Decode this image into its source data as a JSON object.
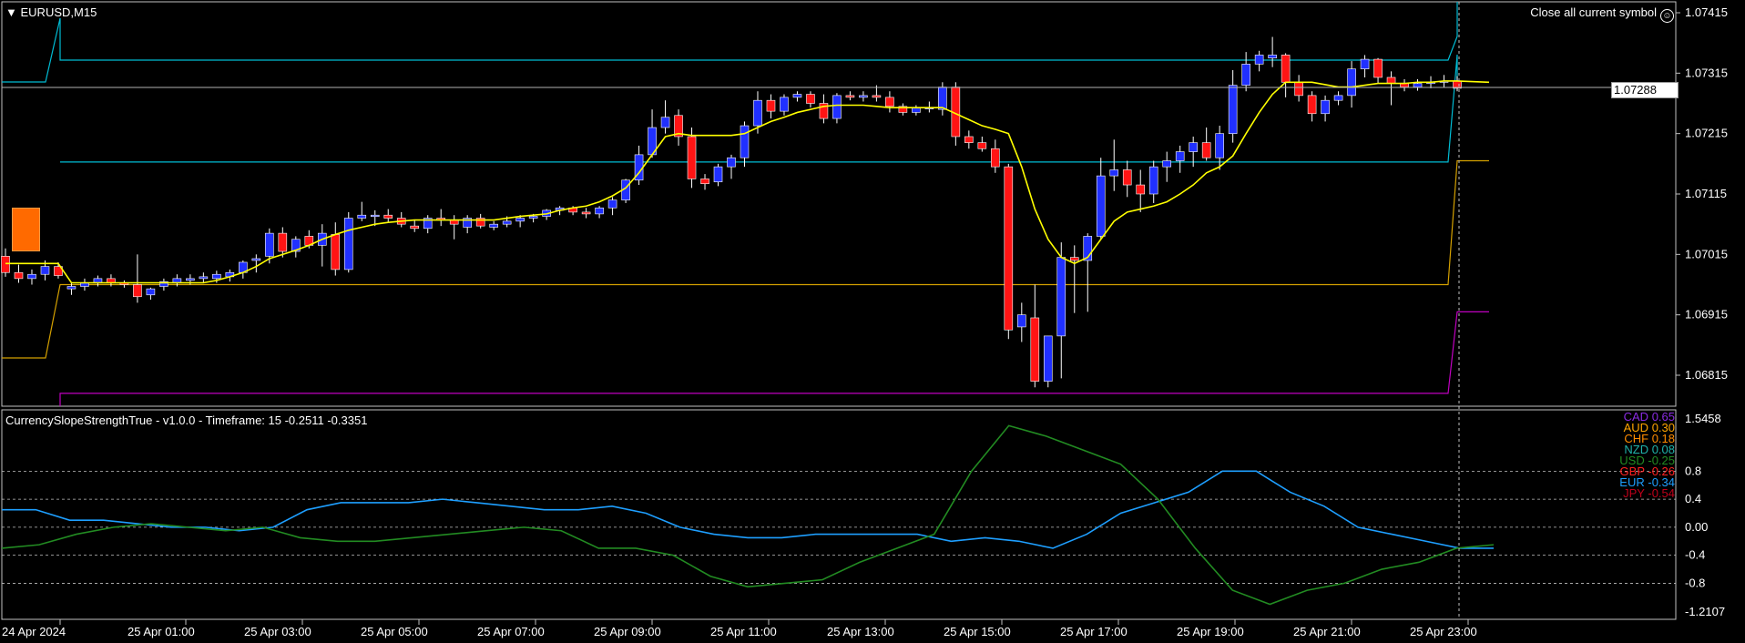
{
  "colors": {
    "background": "#000000",
    "bull_candle": "#2030ff",
    "bear_candle": "#ff1414",
    "ma_line": "#ffff00",
    "channel_upper": "#00bcd4",
    "channel_gold": "#d4a000",
    "channel_purple": "#c000c0",
    "grid": "#c0c0c0",
    "axis_text": "#ffffff"
  },
  "header": {
    "symbol": "EURUSD,M15",
    "close_all_label": "Close all current symbol",
    "smile_icon": "smiley-icon"
  },
  "price_axis": {
    "labels": [
      "1.07415",
      "1.07315",
      "1.07215",
      "1.07115",
      "1.07015",
      "1.06915",
      "1.06815"
    ],
    "current_price": "1.07288"
  },
  "indicator": {
    "title": "CurrencySlopeStrengthTrue  -  v1.0.0  -  Timeframe: 15    -0.2511 -0.3351",
    "axis_labels": [
      "1.5458",
      "0.8",
      "0.4",
      "0.00",
      "-0.4",
      "-0.8",
      "-1.2107"
    ],
    "legend": [
      {
        "name": "CAD",
        "value": "0.65",
        "color": "#8a2be2"
      },
      {
        "name": "AUD",
        "value": "0.30",
        "color": "#ffa500"
      },
      {
        "name": "CHF",
        "value": "0.18",
        "color": "#ff8c00"
      },
      {
        "name": "NZD",
        "value": "0.08",
        "color": "#20b2aa"
      },
      {
        "name": "USD",
        "value": "-0.25",
        "color": "#228b22"
      },
      {
        "name": "GBP",
        "value": "-0.26",
        "color": "#ff2020"
      },
      {
        "name": "EUR",
        "value": "-0.34",
        "color": "#1e9fff"
      },
      {
        "name": "JPY",
        "value": "-0.54",
        "color": "#c0001a"
      }
    ]
  },
  "time_axis": {
    "labels": [
      "24 Apr 2024",
      "25 Apr 01:00",
      "25 Apr 03:00",
      "25 Apr 05:00",
      "25 Apr 07:00",
      "25 Apr 09:00",
      "25 Apr 11:00",
      "25 Apr 13:00",
      "25 Apr 15:00",
      "25 Apr 17:00",
      "25 Apr 19:00",
      "25 Apr 21:00",
      "25 Apr 23:00"
    ]
  },
  "chart_data": {
    "type": "candlestick",
    "symbol": "EURUSD",
    "timeframe": "M15",
    "ylim": [
      1.0676,
      1.0746
    ],
    "candles": [
      [
        1.07012,
        1.07025,
        1.06978,
        1.06985
      ],
      [
        1.06985,
        1.06998,
        1.06968,
        1.06975
      ],
      [
        1.06975,
        1.0699,
        1.06965,
        1.06982
      ],
      [
        1.06982,
        1.07005,
        1.06972,
        1.06995
      ],
      [
        1.06995,
        1.07002,
        1.06975,
        1.0698
      ],
      [
        1.06958,
        1.06968,
        1.06948,
        1.06962
      ],
      [
        1.06962,
        1.06975,
        1.06955,
        1.06968
      ],
      [
        1.06968,
        1.0698,
        1.06962,
        1.06975
      ],
      [
        1.06975,
        1.06982,
        1.06962,
        1.06968
      ],
      [
        1.06968,
        1.06972,
        1.0696,
        1.06965
      ],
      [
        1.06965,
        1.07015,
        1.06935,
        1.06945
      ],
      [
        1.06948,
        1.0696,
        1.0694,
        1.06958
      ],
      [
        1.06962,
        1.06975,
        1.06955,
        1.0697
      ],
      [
        1.06968,
        1.06982,
        1.06962,
        1.06975
      ],
      [
        1.06972,
        1.06982,
        1.06965,
        1.06975
      ],
      [
        1.06975,
        1.06985,
        1.06968,
        1.06978
      ],
      [
        1.06975,
        1.06988,
        1.06968,
        1.06982
      ],
      [
        1.06978,
        1.0699,
        1.0697,
        1.06985
      ],
      [
        1.06985,
        1.07005,
        1.06975,
        1.07002
      ],
      [
        1.07005,
        1.07015,
        1.06985,
        1.07008
      ],
      [
        1.07012,
        1.07058,
        1.07,
        1.0705
      ],
      [
        1.0705,
        1.0706,
        1.0701,
        1.0702
      ],
      [
        1.0702,
        1.07045,
        1.0701,
        1.0704
      ],
      [
        1.07045,
        1.07055,
        1.07025,
        1.0703
      ],
      [
        1.0703,
        1.07065,
        1.06995,
        1.0705
      ],
      [
        1.07048,
        1.07068,
        1.0698,
        1.0699
      ],
      [
        1.0699,
        1.07085,
        1.06985,
        1.07075
      ],
      [
        1.07075,
        1.07102,
        1.0707,
        1.0708
      ],
      [
        1.0708,
        1.07088,
        1.07062,
        1.0708
      ],
      [
        1.0708,
        1.0709,
        1.07068,
        1.07075
      ],
      [
        1.07075,
        1.07085,
        1.0706,
        1.07065
      ],
      [
        1.07062,
        1.07072,
        1.07052,
        1.07058
      ],
      [
        1.07058,
        1.0708,
        1.0705,
        1.07075
      ],
      [
        1.07075,
        1.0709,
        1.07062,
        1.07072
      ],
      [
        1.07072,
        1.0708,
        1.0704,
        1.07065
      ],
      [
        1.0706,
        1.0708,
        1.0705,
        1.07075
      ],
      [
        1.07075,
        1.07082,
        1.07058,
        1.07062
      ],
      [
        1.0706,
        1.0707,
        1.07055,
        1.07065
      ],
      [
        1.07065,
        1.07078,
        1.0706,
        1.0707
      ],
      [
        1.0707,
        1.0708,
        1.0706,
        1.07075
      ],
      [
        1.07075,
        1.07082,
        1.07068,
        1.07078
      ],
      [
        1.07078,
        1.0709,
        1.07072,
        1.07088
      ],
      [
        1.07088,
        1.07095,
        1.0708,
        1.07092
      ],
      [
        1.07092,
        1.07095,
        1.0708,
        1.07085
      ],
      [
        1.07085,
        1.07092,
        1.07075,
        1.07082
      ],
      [
        1.07082,
        1.07095,
        1.07075,
        1.07092
      ],
      [
        1.07092,
        1.0711,
        1.0708,
        1.07105
      ],
      [
        1.07105,
        1.0714,
        1.071,
        1.07138
      ],
      [
        1.07138,
        1.07195,
        1.0713,
        1.0718
      ],
      [
        1.0718,
        1.07255,
        1.07175,
        1.07225
      ],
      [
        1.07225,
        1.0727,
        1.07215,
        1.07242
      ],
      [
        1.07245,
        1.07255,
        1.07195,
        1.0721
      ],
      [
        1.0721,
        1.07225,
        1.07125,
        1.0714
      ],
      [
        1.0714,
        1.07148,
        1.07122,
        1.07132
      ],
      [
        1.07135,
        1.07165,
        1.07128,
        1.0716
      ],
      [
        1.0716,
        1.0718,
        1.0714,
        1.07175
      ],
      [
        1.07175,
        1.07235,
        1.0716,
        1.07228
      ],
      [
        1.07228,
        1.07285,
        1.07215,
        1.0727
      ],
      [
        1.0727,
        1.0728,
        1.0724,
        1.07252
      ],
      [
        1.07252,
        1.0728,
        1.07245,
        1.07275
      ],
      [
        1.07275,
        1.07285,
        1.07268,
        1.0728
      ],
      [
        1.0728,
        1.07285,
        1.07258,
        1.07265
      ],
      [
        1.07265,
        1.0728,
        1.07232,
        1.0724
      ],
      [
        1.0724,
        1.07282,
        1.07232,
        1.07278
      ],
      [
        1.07278,
        1.07285,
        1.0727,
        1.07275
      ],
      [
        1.07275,
        1.07285,
        1.07268,
        1.07278
      ],
      [
        1.07278,
        1.07295,
        1.07268,
        1.07275
      ],
      [
        1.07275,
        1.07285,
        1.0725,
        1.0726
      ],
      [
        1.0726,
        1.07265,
        1.07245,
        1.0725
      ],
      [
        1.0725,
        1.07262,
        1.07245,
        1.07258
      ],
      [
        1.07258,
        1.07268,
        1.0725,
        1.07258
      ],
      [
        1.07255,
        1.073,
        1.07245,
        1.07292
      ],
      [
        1.07292,
        1.073,
        1.07195,
        1.0721
      ],
      [
        1.0721,
        1.0722,
        1.0719,
        1.072
      ],
      [
        1.072,
        1.0721,
        1.07185,
        1.0719
      ],
      [
        1.0719,
        1.07205,
        1.0715,
        1.0716
      ],
      [
        1.0716,
        1.07165,
        1.06875,
        1.0689
      ],
      [
        1.06895,
        1.06935,
        1.0687,
        1.06915
      ],
      [
        1.0691,
        1.06965,
        1.06795,
        1.06805
      ],
      [
        1.06805,
        1.0688,
        1.06795,
        1.0688
      ],
      [
        1.0688,
        1.07035,
        1.0681,
        1.0701
      ],
      [
        1.0701,
        1.0703,
        1.06918,
        1.07005
      ],
      [
        1.07005,
        1.0705,
        1.0692,
        1.07045
      ],
      [
        1.07045,
        1.07175,
        1.0704,
        1.07145
      ],
      [
        1.07145,
        1.07205,
        1.0712,
        1.07155
      ],
      [
        1.07155,
        1.0717,
        1.0711,
        1.0713
      ],
      [
        1.0713,
        1.07155,
        1.07085,
        1.07115
      ],
      [
        1.07115,
        1.0717,
        1.071,
        1.0716
      ],
      [
        1.0716,
        1.07185,
        1.07135,
        1.0717
      ],
      [
        1.0717,
        1.07195,
        1.0715,
        1.07185
      ],
      [
        1.07185,
        1.0721,
        1.0716,
        1.072
      ],
      [
        1.072,
        1.07225,
        1.0717,
        1.07175
      ],
      [
        1.07175,
        1.07228,
        1.07155,
        1.07215
      ],
      [
        1.07215,
        1.0732,
        1.072,
        1.07295
      ],
      [
        1.07295,
        1.0735,
        1.07285,
        1.0733
      ],
      [
        1.0733,
        1.07352,
        1.07318,
        1.07345
      ],
      [
        1.0734,
        1.07375,
        1.07325,
        1.07345
      ],
      [
        1.07345,
        1.07348,
        1.07275,
        1.073
      ],
      [
        1.073,
        1.07312,
        1.07268,
        1.07278
      ],
      [
        1.07278,
        1.07285,
        1.07235,
        1.07248
      ],
      [
        1.07248,
        1.07278,
        1.07235,
        1.0727
      ],
      [
        1.0727,
        1.07285,
        1.07262,
        1.07278
      ],
      [
        1.07278,
        1.07335,
        1.07258,
        1.07322
      ],
      [
        1.07322,
        1.07345,
        1.07308,
        1.07338
      ],
      [
        1.07338,
        1.0734,
        1.07298,
        1.07308
      ],
      [
        1.07308,
        1.07318,
        1.07262,
        1.07298
      ],
      [
        1.07298,
        1.07305,
        1.07285,
        1.07292
      ],
      [
        1.07292,
        1.07305,
        1.07286,
        1.07298
      ],
      [
        1.07298,
        1.0731,
        1.0729,
        1.073
      ],
      [
        1.073,
        1.07312,
        1.07292,
        1.07302
      ],
      [
        1.07302,
        1.0731,
        1.07285,
        1.0729
      ]
    ],
    "ma": [
      1.07,
      1.07,
      1.07,
      1.07,
      1.07,
      1.06968,
      1.06968,
      1.06968,
      1.06968,
      1.06968,
      1.06968,
      1.06968,
      1.06968,
      1.06968,
      1.06968,
      1.06968,
      1.06972,
      1.06978,
      1.06985,
      1.06995,
      1.07008,
      1.07015,
      1.07022,
      1.0703,
      1.0704,
      1.07048,
      1.07055,
      1.0706,
      1.07065,
      1.07068,
      1.0707,
      1.07072,
      1.07072,
      1.07072,
      1.07072,
      1.07072,
      1.07072,
      1.07072,
      1.07075,
      1.07078,
      1.0708,
      1.07082,
      1.07088,
      1.07092,
      1.07095,
      1.07102,
      1.07112,
      1.07125,
      1.0715,
      1.0718,
      1.0721,
      1.07215,
      1.07212,
      1.07212,
      1.07212,
      1.07212,
      1.07215,
      1.07225,
      1.07235,
      1.07242,
      1.0725,
      1.07255,
      1.0726,
      1.07262,
      1.07262,
      1.07262,
      1.0726,
      1.07258,
      1.07258,
      1.07258,
      1.07258,
      1.07258,
      1.07248,
      1.07238,
      1.07228,
      1.07222,
      1.07215,
      1.0716,
      1.0709,
      1.0704,
      1.0701,
      1.07,
      1.0701,
      1.0704,
      1.0707,
      1.07085,
      1.0709,
      1.07095,
      1.07102,
      1.07115,
      1.0713,
      1.0715,
      1.0716,
      1.07178,
      1.07215,
      1.0725,
      1.0728,
      1.073,
      1.073,
      1.073,
      1.07296,
      1.07292,
      1.07292,
      1.07295,
      1.07298,
      1.07298,
      1.07298,
      1.073,
      1.073,
      1.07302,
      1.07302
    ],
    "channel_cyan_upper": 1.07332,
    "channel_cyan_lower": 1.07168,
    "channel_gold": 1.06965,
    "channel_purple": 1.06785,
    "indicator_series": [
      {
        "name": "EUR",
        "color": "#1e9fff",
        "values": [
          0.25,
          0.25,
          0.1,
          0.1,
          0.05,
          0.0,
          0.0,
          -0.05,
          0.0,
          0.25,
          0.35,
          0.35,
          0.35,
          0.4,
          0.35,
          0.3,
          0.25,
          0.25,
          0.3,
          0.2,
          0.0,
          -0.1,
          -0.15,
          -0.15,
          -0.1,
          -0.1,
          -0.1,
          -0.1,
          -0.2,
          -0.15,
          -0.2,
          -0.3,
          -0.1,
          0.2,
          0.35,
          0.5,
          0.8,
          0.8,
          0.5,
          0.3,
          0.0,
          -0.1,
          -0.2,
          -0.3,
          -0.3
        ]
      },
      {
        "name": "USD",
        "color": "#228b22",
        "values": [
          -0.3,
          -0.25,
          -0.1,
          0.0,
          0.05,
          0.0,
          -0.05,
          0.0,
          -0.15,
          -0.2,
          -0.2,
          -0.15,
          -0.1,
          -0.05,
          0.0,
          -0.05,
          -0.3,
          -0.3,
          -0.4,
          -0.7,
          -0.85,
          -0.8,
          -0.75,
          -0.5,
          -0.3,
          -0.1,
          0.8,
          1.45,
          1.3,
          1.1,
          0.9,
          0.4,
          -0.3,
          -0.9,
          -1.1,
          -0.9,
          -0.8,
          -0.6,
          -0.5,
          -0.3,
          -0.25
        ]
      }
    ]
  }
}
